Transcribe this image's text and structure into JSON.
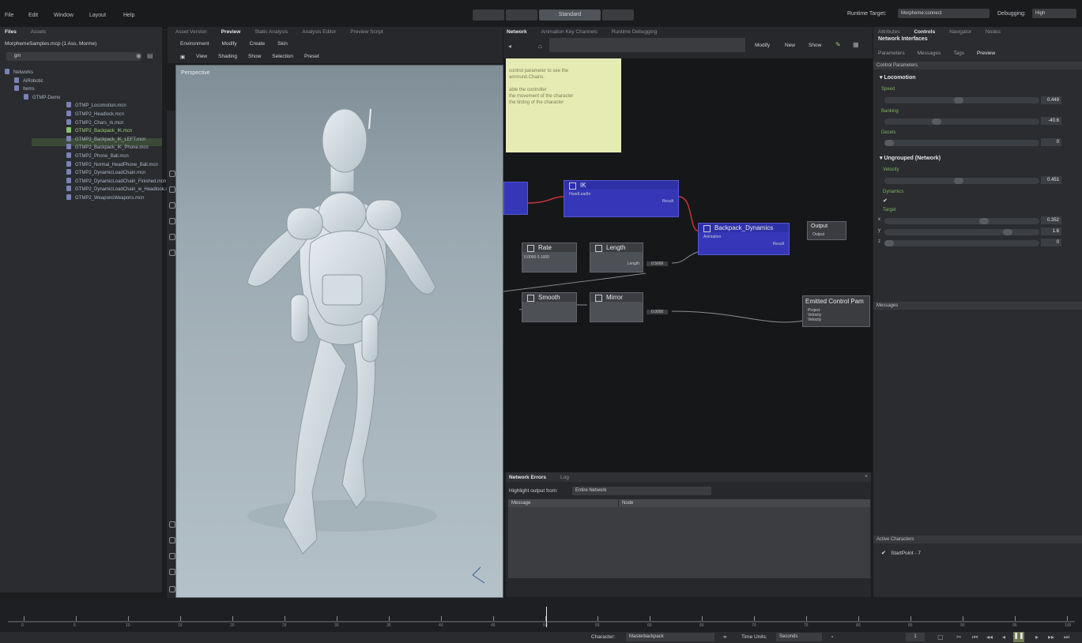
{
  "menu": [
    "File",
    "Edit",
    "Window",
    "Layout",
    "Help"
  ],
  "layout_tabs": [
    "",
    "",
    "Standard",
    ""
  ],
  "runtime": {
    "label": "Runtime Target:",
    "value": "Morpheme:connect",
    "debug_label": "Debugging:",
    "debug_value": "High"
  },
  "files": {
    "tabs": [
      "Files",
      "Assets"
    ],
    "project": "MorphemeSamples.mcp",
    "project_suffix": "(1 Ass, Morme)",
    "search": "gm",
    "tree": [
      {
        "label": "Networks",
        "level": 0
      },
      {
        "label": "AiRobotic",
        "level": 1
      },
      {
        "label": "Items",
        "level": 1
      },
      {
        "label": "GTMP-Demo",
        "level": 2
      },
      {
        "label": "GTMP_Locomotion.mcn",
        "level": 3
      },
      {
        "label": "GTMP2_Headlock.mcn",
        "level": 3
      },
      {
        "label": "GTMP2_Chars_rk.mcn",
        "level": 3
      },
      {
        "label": "GTMP2_Backpack_IK.mcn",
        "level": 3,
        "highlight": true
      },
      {
        "label": "GTMP2_Backpack_IK_LEFT.mcn",
        "level": 3
      },
      {
        "label": "GTMP2_Backpack_IK_Phone.mcn",
        "level": 3
      },
      {
        "label": "GTMP2_Phone_Ball.mcn",
        "level": 3
      },
      {
        "label": "GTMP2_Normal_HeadPhone_Ball.mcn",
        "level": 3
      },
      {
        "label": "GTMP2_DynamicLoadChain.mcn",
        "level": 3
      },
      {
        "label": "GTMP2_DynamicLoadChain_Finished.mcn",
        "level": 3
      },
      {
        "label": "GTMP2_DynamicLoadChain_w_Headlook.mcn",
        "level": 3
      },
      {
        "label": "GTMP2_WeaponsWeapons.mcn",
        "level": 3
      }
    ]
  },
  "viewport": {
    "tabs": [
      "Asset Version",
      "Preview",
      "Static Analysis",
      "Analysis Editor",
      "Preview Script"
    ],
    "active_tab": "Preview",
    "menu1": [
      "Environment",
      "Modify",
      "Create",
      "Skin"
    ],
    "menu2": [
      "View",
      "Shading",
      "Show",
      "Selection",
      "Preset"
    ],
    "label": "Perspective"
  },
  "network": {
    "tabs": [
      "Network",
      "Animation Key Channels",
      "Runtime Debugging"
    ],
    "toolbar": [
      "Modify",
      "New",
      "Show"
    ],
    "note_lines": [
      "control parameter to see the",
      "ammunit.Chains.",
      "",
      "able the controller",
      "the movement of the character",
      "the tinting of the character"
    ],
    "nodes": {
      "ik": "IK",
      "ik_port": "HeadLeadIn",
      "ik_out": "Result",
      "rate": "Rate",
      "length": "Length",
      "smooth": "Smooth",
      "mirror": "Mirror",
      "backpack": "Backpack_Dynamics",
      "backpack_port": "Animation",
      "backpack_out": "Result",
      "output": "Output",
      "output_port": "Output",
      "emitted": "Emitted Control Pam",
      "emitted_ports": [
        "Project",
        "Velocity",
        "Velocity"
      ],
      "length_out": "Length",
      "length_val": "0.5000",
      "mirror_val": "0.0000",
      "rate_vals": "0.0000  0.1000"
    }
  },
  "errors": {
    "tabs": [
      "Network Errors",
      "Log"
    ],
    "filter_label": "Highlight output from:",
    "filter_value": "Entire Network",
    "columns": [
      "Message",
      "Node"
    ]
  },
  "props": {
    "tabs": [
      "Attributes",
      "Controls",
      "Navigator",
      "Nodes"
    ],
    "active_tab": "Controls",
    "title": "Network Interfaces",
    "subtabs": [
      "Parameters",
      "Messages",
      "Tags",
      "Preview"
    ],
    "section_header": "Control Parameters",
    "groups": [
      {
        "name": "Locomotion",
        "params": [
          {
            "name": "Speed",
            "value": "0.449",
            "fraction": 0.45
          },
          {
            "name": "Banking",
            "value": "-40.6",
            "fraction": 0.3
          },
          {
            "name": "Decels",
            "value": "0",
            "fraction": 0.0
          }
        ]
      },
      {
        "name": "Ungrouped (Network)",
        "params": [
          {
            "name": "Velocity",
            "value": "0.451",
            "fraction": 0.45
          },
          {
            "name": "Dynamics",
            "value": "",
            "fraction": 0.0
          },
          {
            "name": "Target",
            "value": "",
            "fraction": 0.0
          }
        ]
      }
    ],
    "target": [
      {
        "axis": "x",
        "value": "0.352"
      },
      {
        "axis": "y",
        "value": "1.6"
      },
      {
        "axis": "z",
        "value": "0"
      }
    ],
    "messages": "Messages",
    "active_characters": "Active Characters",
    "character": "StartPoint - 7"
  },
  "status": {
    "character_label": "Character:",
    "character_value": "Masterbackpack",
    "time_label": "Time Units:",
    "time_value": "Seconds",
    "frame": "1",
    "ticks": [
      "0",
      "5",
      "10",
      "15",
      "20",
      "25",
      "30",
      "35",
      "40",
      "45",
      "50",
      "55",
      "60",
      "65",
      "70",
      "75",
      "80",
      "85",
      "90",
      "95",
      "100"
    ]
  }
}
